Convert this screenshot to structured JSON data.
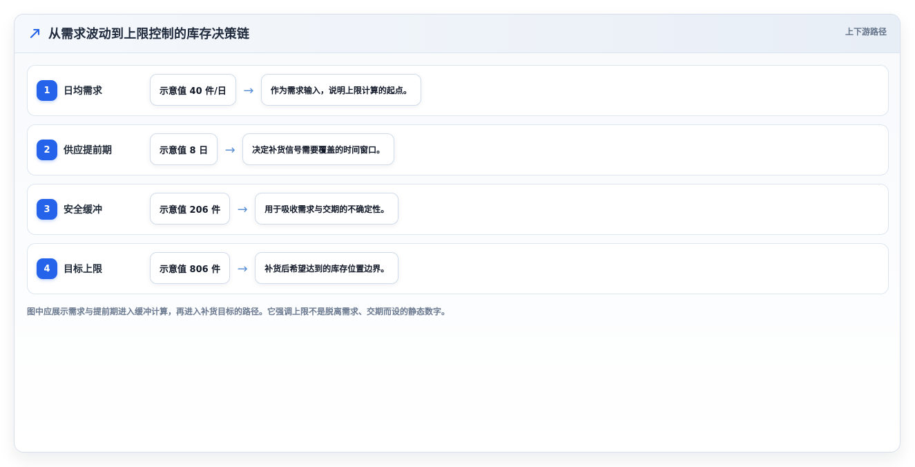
{
  "panel": {
    "icon": "trend-up-arrow-icon",
    "title": "从需求波动到上限控制的库存决策链",
    "path_label": "上下游路径",
    "accent_color": "#2563eb",
    "arrow_color": "#5b8fd6"
  },
  "steps": [
    {
      "number": "1",
      "label": "日均需求",
      "value": "示意值 40 件/日",
      "arrow": "→",
      "description": "作为需求输入，说明上限计算的起点。"
    },
    {
      "number": "2",
      "label": "供应提前期",
      "value": "示意值 8 日",
      "arrow": "→",
      "description": "决定补货信号需要覆盖的时间窗口。"
    },
    {
      "number": "3",
      "label": "安全缓冲",
      "value": "示意值 206 件",
      "arrow": "→",
      "description": "用于吸收需求与交期的不确定性。"
    },
    {
      "number": "4",
      "label": "目标上限",
      "value": "示意值 806 件",
      "arrow": "→",
      "description": "补货后希望达到的库存位置边界。"
    }
  ],
  "note": "图中应展示需求与提前期进入缓冲计算，再进入补货目标的路径。它强调上限不是脱离需求、交期而设的静态数字。"
}
